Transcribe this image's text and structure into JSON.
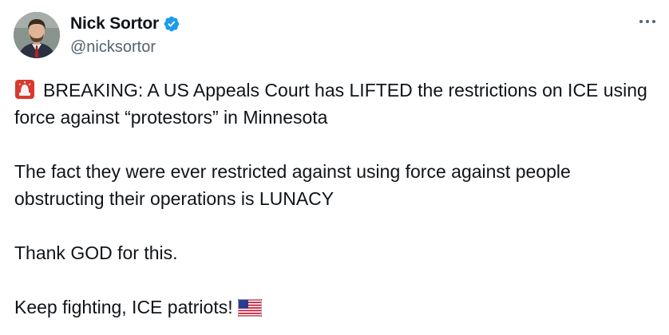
{
  "author": {
    "display_name": "Nick Sortor",
    "handle": "@nicksortor",
    "avatar_icon": "user-avatar-photo",
    "verified_icon": "verified-badge-icon",
    "verified_color": "#1d9bf0"
  },
  "menu": {
    "more_icon": "more-options-icon"
  },
  "tweet": {
    "p1_icon": "police-siren-emoji",
    "p1_text": "BREAKING: A US Appeals Court has LIFTED the restrictions on ICE using force against “protestors” in Minnesota",
    "p2_text": "The fact they were ever restricted against using force against people obstructing their operations is LUNACY",
    "p3_text": "Thank GOD for this.",
    "p4_text": "Keep fighting, ICE patriots!",
    "p4_icon": "us-flag-emoji"
  },
  "colors": {
    "text": "#0f1419",
    "secondary": "#536471",
    "background": "#ffffff"
  }
}
